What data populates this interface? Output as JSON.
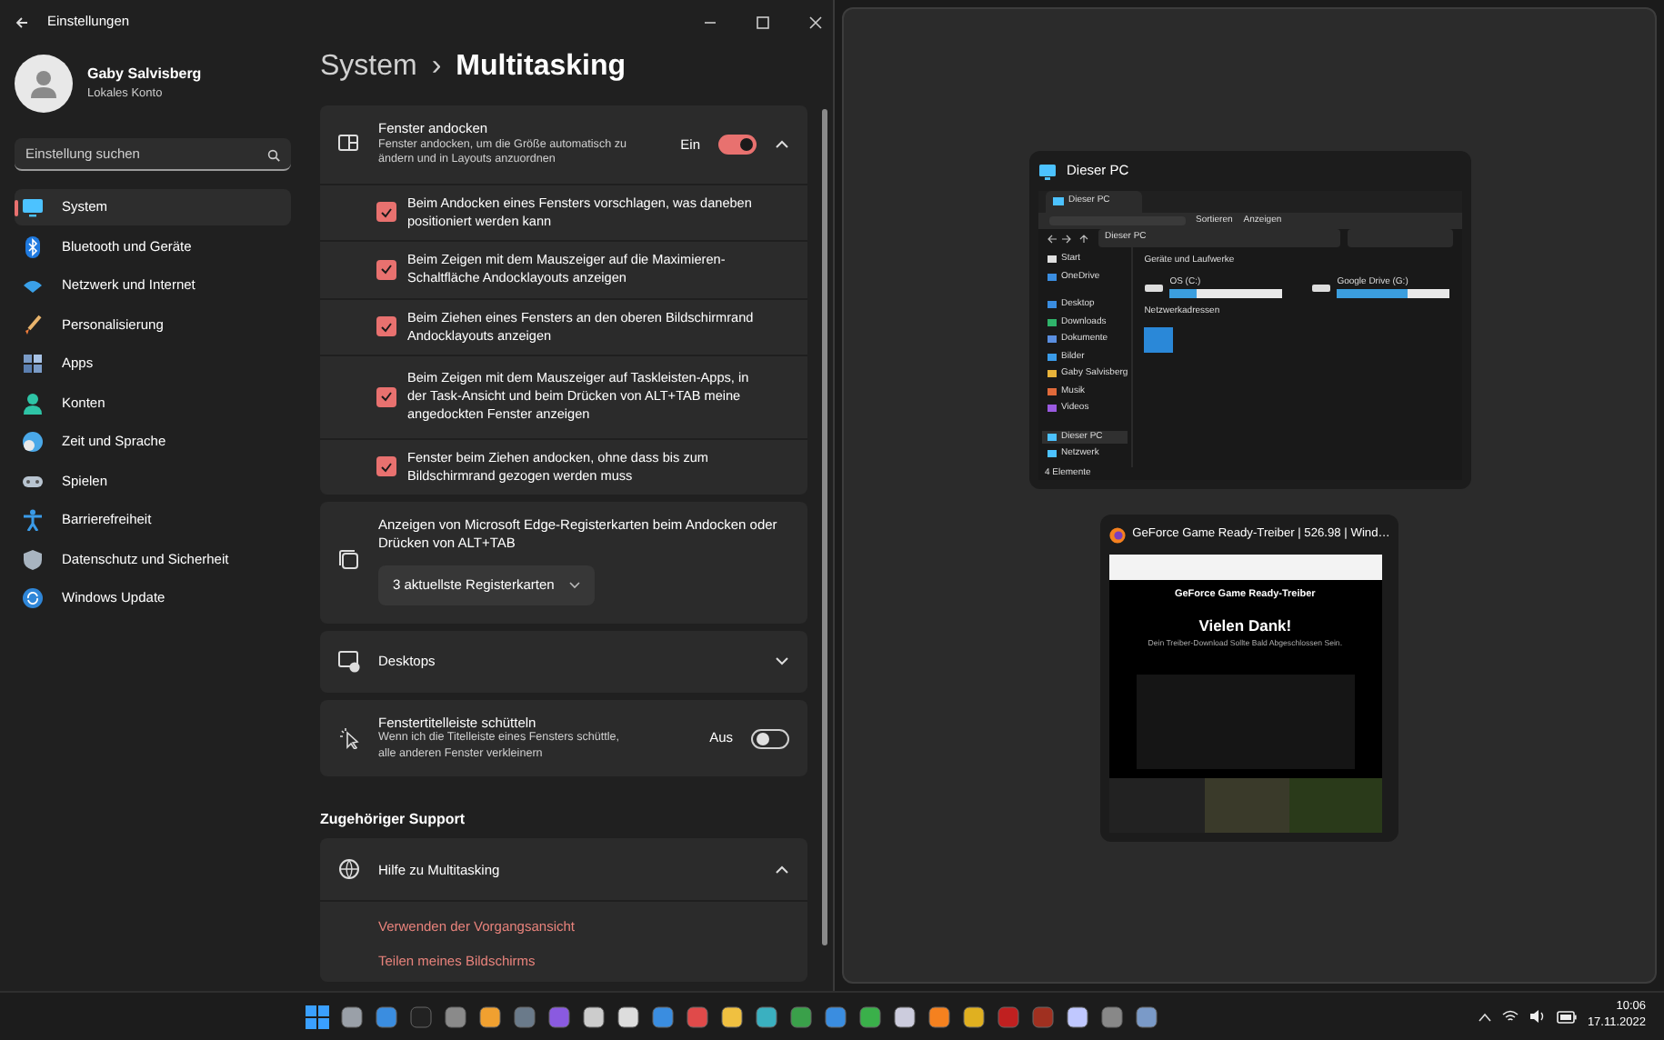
{
  "window": {
    "title": "Einstellungen"
  },
  "account": {
    "name": "Gaby Salvisberg",
    "type": "Lokales Konto"
  },
  "search": {
    "placeholder": "Einstellung suchen"
  },
  "sidebar": {
    "items": [
      {
        "label": "System",
        "selected": true
      },
      {
        "label": "Bluetooth und Geräte",
        "selected": false
      },
      {
        "label": "Netzwerk und Internet",
        "selected": false
      },
      {
        "label": "Personalisierung",
        "selected": false
      },
      {
        "label": "Apps",
        "selected": false
      },
      {
        "label": "Konten",
        "selected": false
      },
      {
        "label": "Zeit und Sprache",
        "selected": false
      },
      {
        "label": "Spielen",
        "selected": false
      },
      {
        "label": "Barrierefreiheit",
        "selected": false
      },
      {
        "label": "Datenschutz und Sicherheit",
        "selected": false
      },
      {
        "label": "Windows Update",
        "selected": false
      }
    ]
  },
  "breadcrumb": {
    "parent": "System",
    "separator": "›",
    "current": "Multitasking"
  },
  "sections": [
    {
      "kind": "toggle-group",
      "title": "Fenster andocken",
      "description": "Fenster andocken, um die Größe automatisch zu ändern und in Layouts anzuordnen",
      "state_label": "Ein",
      "on": true,
      "expanded": true,
      "options": [
        {
          "label": "Beim Andocken eines Fensters vorschlagen, was daneben positioniert werden kann",
          "checked": true
        },
        {
          "label": "Beim Zeigen mit dem Mauszeiger auf die Maximieren-Schaltfläche Andocklayouts anzeigen",
          "checked": true
        },
        {
          "label": "Beim Ziehen eines Fensters an den oberen Bildschirmrand Andocklayouts anzeigen",
          "checked": true
        },
        {
          "label": "Beim Zeigen mit dem Mauszeiger auf Taskleisten-Apps, in der Task-Ansicht und beim Drücken von ALT+TAB meine angedockten Fenster anzeigen",
          "checked": true
        },
        {
          "label": "Fenster beim Ziehen andocken, ohne dass bis zum Bildschirmrand gezogen werden muss",
          "checked": true
        }
      ]
    },
    {
      "kind": "dropdown",
      "title": "Anzeigen von Microsoft Edge-Registerkarten beim Andocken oder Drücken von ALT+TAB",
      "value": "3 aktuellste Registerkarten"
    },
    {
      "kind": "expander",
      "title": "Desktops",
      "expanded": false
    },
    {
      "kind": "toggle",
      "title": "Fenstertitelleiste schütteln",
      "description": "Wenn ich die Titelleiste eines Fensters schüttle, alle anderen Fenster verkleinern",
      "state_label": "Aus",
      "on": false
    }
  ],
  "support": {
    "heading": "Zugehöriger Support",
    "title": "Hilfe zu Multitasking",
    "expanded": true,
    "links": [
      "Verwenden der Vorgangsansicht",
      "Teilen meines Bildschirms"
    ]
  },
  "snap_assist": {
    "explorer": {
      "title": "Dieser PC",
      "tab": "Dieser PC",
      "toolbar": [
        "Sortieren",
        "Anzeigen"
      ],
      "address": "Dieser PC",
      "nav": [
        {
          "label": "Start",
          "selected": false
        },
        {
          "label": "OneDrive",
          "selected": false
        },
        {
          "label": "Desktop",
          "selected": false
        },
        {
          "label": "Downloads",
          "selected": false
        },
        {
          "label": "Dokumente",
          "selected": false
        },
        {
          "label": "Bilder",
          "selected": false
        },
        {
          "label": "Gaby Salvisberg",
          "selected": false
        },
        {
          "label": "Musik",
          "selected": false
        },
        {
          "label": "Videos",
          "selected": false
        },
        {
          "label": "Dieser PC",
          "selected": true
        },
        {
          "label": "Netzwerk",
          "selected": false
        }
      ],
      "drives_heading": "Geräte und Laufwerke",
      "drives": [
        {
          "label": "OS (C:)",
          "level": 0.24
        },
        {
          "label": "Google Drive (G:)",
          "level": 0.62
        }
      ],
      "network_heading": "Netzwerkadressen",
      "status": "4 Elemente"
    },
    "browser": {
      "title": "GeForce Game Ready-Treiber | 526.98 | Wind…",
      "page_heading": "GeForce Game Ready-Treiber",
      "message": "Vielen Dank!",
      "submessage": "Dein Treiber-Download Sollte Bald Abgeschlossen Sein."
    }
  },
  "taskbar": {
    "time": "10:06",
    "date": "17.11.2022"
  }
}
